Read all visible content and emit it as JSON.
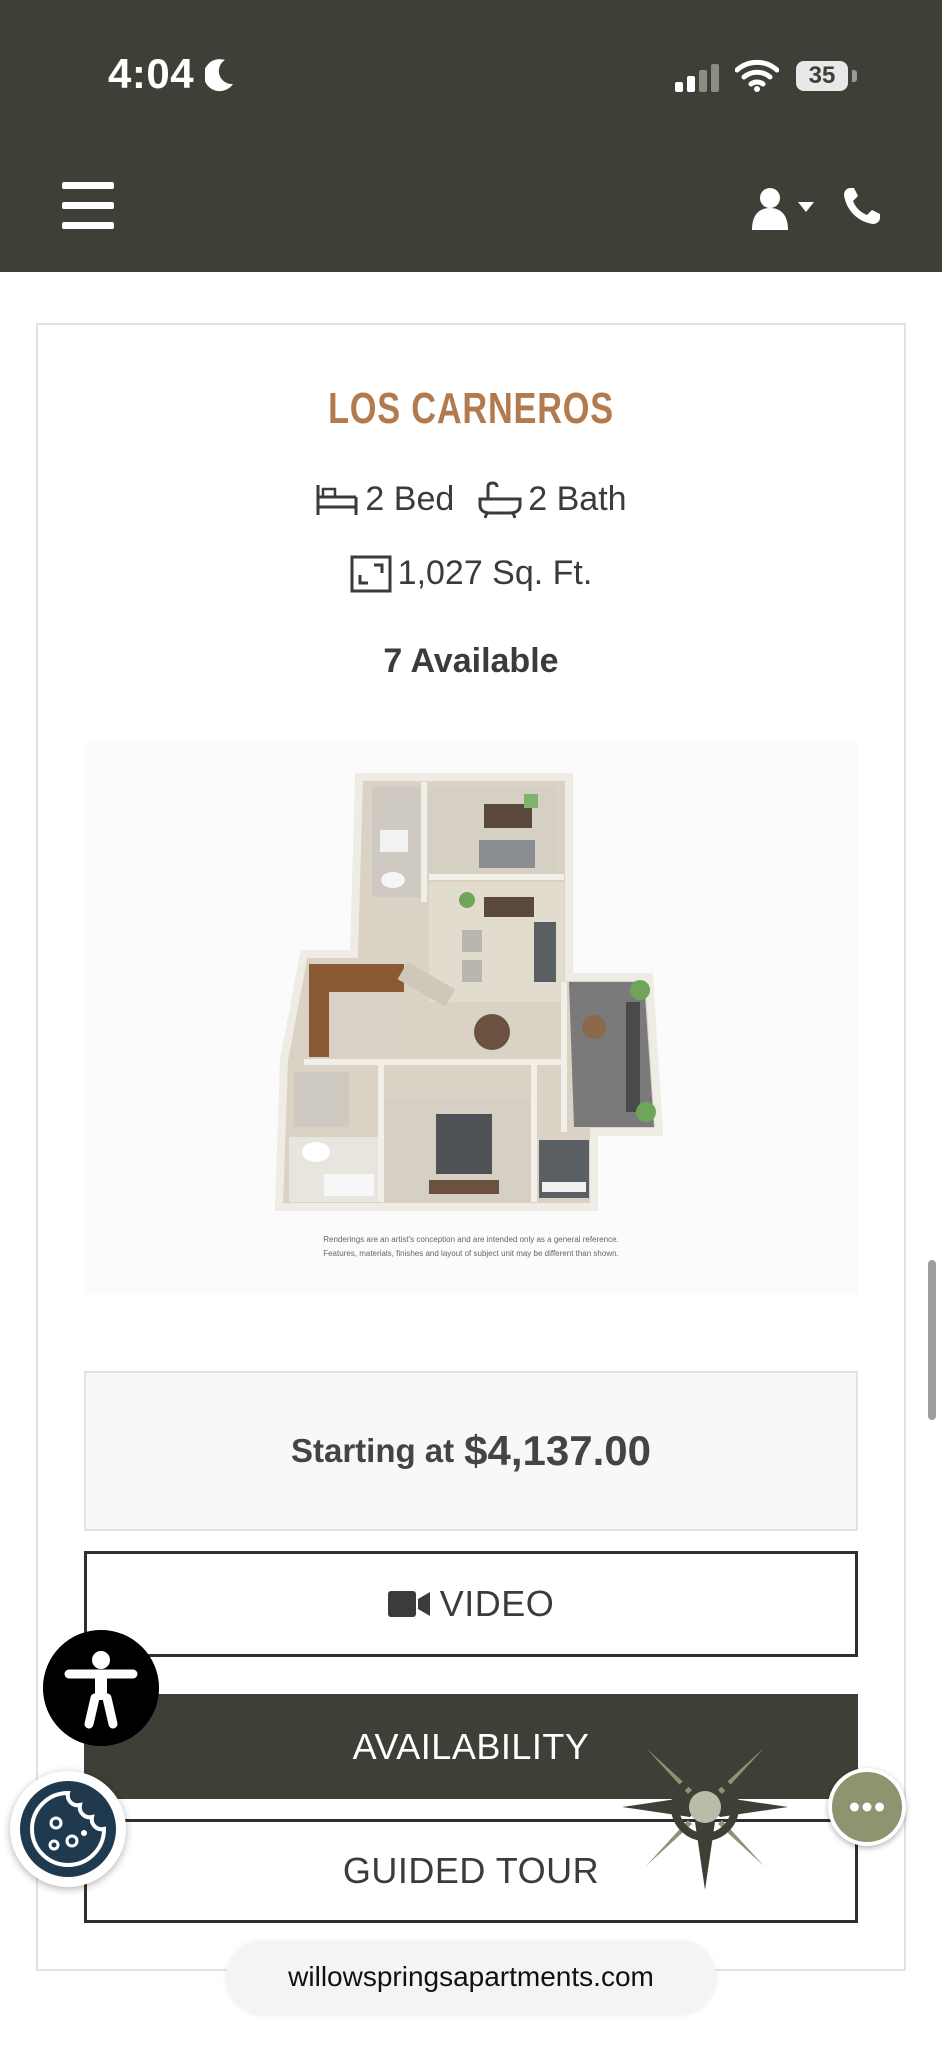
{
  "status_bar": {
    "time": "4:04",
    "battery": "35"
  },
  "nav": {
    "menu_icon": "hamburger-icon",
    "account_icon": "user-dropdown-icon",
    "phone_icon": "phone-icon"
  },
  "floor_plan": {
    "name": "LOS CARNEROS",
    "beds": "2 Bed",
    "baths": "2 Bath",
    "area": "1,027 Sq. Ft.",
    "availability": "7 Available",
    "disclaimer_line1": "Renderings are an artist's conception and are intended only as a general reference.",
    "disclaimer_line2": "Features, materials, finishes and layout of subject unit may be different than shown.",
    "price_prefix": "Starting at",
    "price": "$4,137.00",
    "video_label": "VIDEO",
    "availability_label": "AVAILABILITY",
    "tour_label": "GUIDED TOUR"
  },
  "browser": {
    "url": "willowspringsapartments.com"
  },
  "colors": {
    "header_bg": "#3c4036",
    "accent_title": "#b27a4d",
    "chat_button": "#8f9470"
  }
}
